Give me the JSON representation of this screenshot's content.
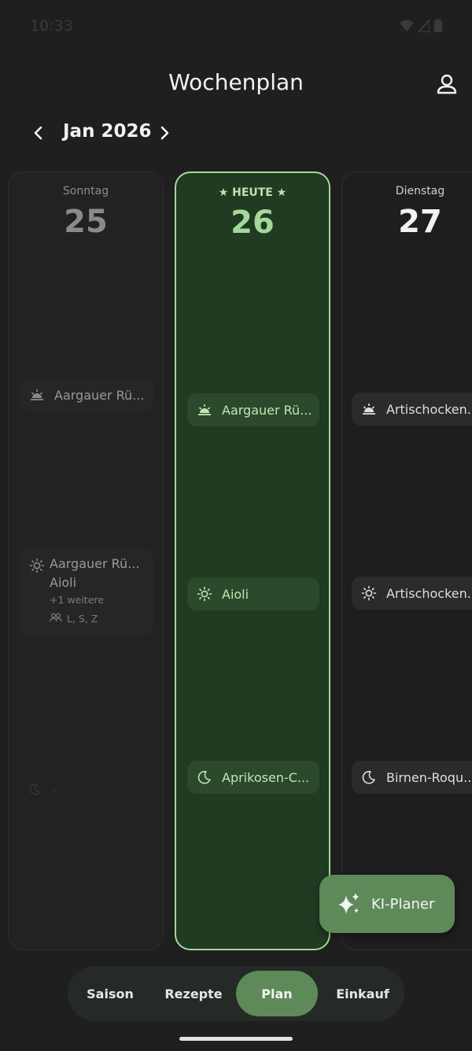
{
  "status_bar": {
    "time": "10:33"
  },
  "header": {
    "title": "Wochenplan"
  },
  "month_nav": {
    "label": "Jan 2026"
  },
  "days": [
    {
      "name": "Sonntag",
      "number": "25",
      "breakfast": "Aargauer Rü...",
      "lunch_lines": [
        "Aargauer Rü...",
        "Aioli",
        "+1 weitere"
      ],
      "lunch_persons": "L, S, Z",
      "dinner": "–"
    },
    {
      "name": "★ HEUTE ★",
      "number": "26",
      "breakfast": "Aargauer Rü...",
      "lunch": "Aioli",
      "dinner": "Aprikosen-C..."
    },
    {
      "name": "Dienstag",
      "number": "27",
      "breakfast": "Artischocken...",
      "lunch": "Artischocken...",
      "dinner": "Birnen-Roqu..."
    }
  ],
  "fab": {
    "label": "KI-Planer"
  },
  "bottom_nav": {
    "items": [
      "Saison",
      "Rezepte",
      "Plan",
      "Einkauf"
    ],
    "active": "Plan"
  },
  "colors": {
    "accent": "#a5d89b",
    "today_bg": "#213a22",
    "button_green": "#5e8a5a",
    "background": "#1f1f1f"
  },
  "icons": [
    "wifi-icon",
    "signal-icon",
    "battery-icon",
    "profile-icon",
    "chevron-left-icon",
    "chevron-right-icon",
    "sunrise-icon",
    "sun-icon",
    "moon-icon",
    "persons-icon",
    "sparkle-icon"
  ]
}
